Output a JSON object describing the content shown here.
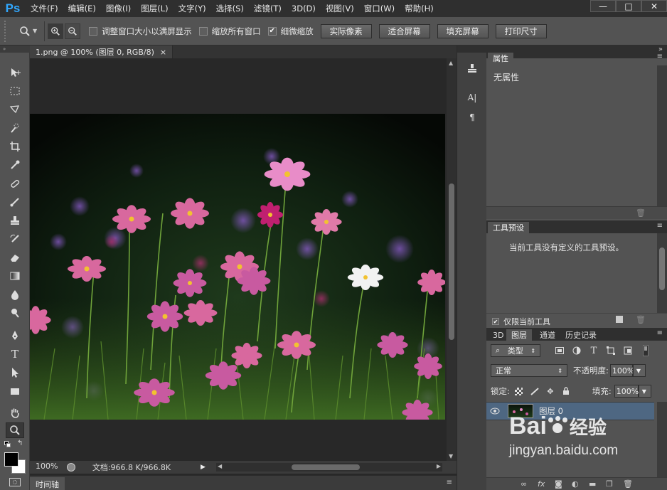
{
  "app": {
    "logo": "Ps"
  },
  "menu": [
    "文件(F)",
    "编辑(E)",
    "图像(I)",
    "图层(L)",
    "文字(Y)",
    "选择(S)",
    "滤镜(T)",
    "3D(D)",
    "视图(V)",
    "窗口(W)",
    "帮助(H)"
  ],
  "window_controls": {
    "minimize": "—",
    "maximize": "□",
    "close": "✕"
  },
  "options": {
    "checkbox1_label": "调整窗口大小以满屏显示",
    "checkbox1_checked": false,
    "checkbox2_label": "缩放所有窗口",
    "checkbox2_checked": false,
    "checkbox3_label": "细微缩放",
    "checkbox3_checked": true,
    "btn_actual": "实际像素",
    "btn_fit": "适合屏幕",
    "btn_fill": "填充屏幕",
    "btn_print": "打印尺寸"
  },
  "document": {
    "tab_title": "1.png @ 100% (图层 0, RGB/8)",
    "tab_close": "×",
    "zoom": "100%",
    "doc_info": "文档:966.8 K/966.8K"
  },
  "timeline": {
    "label": "时间轴"
  },
  "properties": {
    "tab": "属性",
    "content": "无属性"
  },
  "tool_presets": {
    "tab": "工具预设",
    "content": "当前工具没有定义的工具预设。",
    "current_only_label": "仅限当前工具",
    "current_only_checked": true
  },
  "layers_panel": {
    "tabs": [
      "3D",
      "图层",
      "通道",
      "历史记录"
    ],
    "active_tab": "图层",
    "filter_kind": "类型",
    "blend_mode": "正常",
    "opacity_label": "不透明度:",
    "opacity_value": "100%",
    "lock_label": "锁定:",
    "fill_label": "填充:",
    "fill_value": "100%",
    "layers": [
      {
        "name": "图层 0",
        "visible": true
      }
    ]
  },
  "watermark": {
    "brand": "Bai",
    "brand2": "经验",
    "url": "jingyan.baidu.com"
  },
  "colors": {
    "accent": "#31a8ff",
    "panel": "#535353",
    "dark": "#2f2f2f",
    "selected_layer": "#4e6782"
  }
}
